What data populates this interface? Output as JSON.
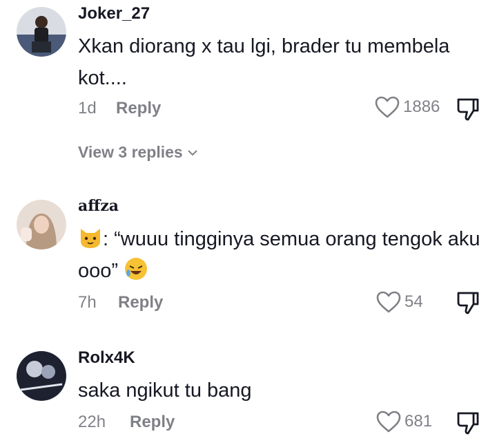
{
  "comments": [
    {
      "username": "Joker_27",
      "text": "Xkan diorang x tau lgi, brader tu membela kot....",
      "age": "1d",
      "reply_label": "Reply",
      "likes": "1886",
      "view_replies": "View 3 replies"
    },
    {
      "username": "affza",
      "text_prefix": ": “wuuu tingginya semua orang tengok aku ooo”",
      "age": "7h",
      "reply_label": "Reply",
      "likes": "54"
    },
    {
      "username": "Rolx4K",
      "text": "saka ngikut tu bang",
      "age": "22h",
      "reply_label": "Reply",
      "likes": "681"
    }
  ],
  "icons": {
    "like": "heart-outline-icon",
    "dislike": "thumbs-down-icon",
    "expand": "chevron-down-icon",
    "emoji_1": "cat-face-emoji",
    "emoji_2": "rolling-laughing-emoji"
  }
}
